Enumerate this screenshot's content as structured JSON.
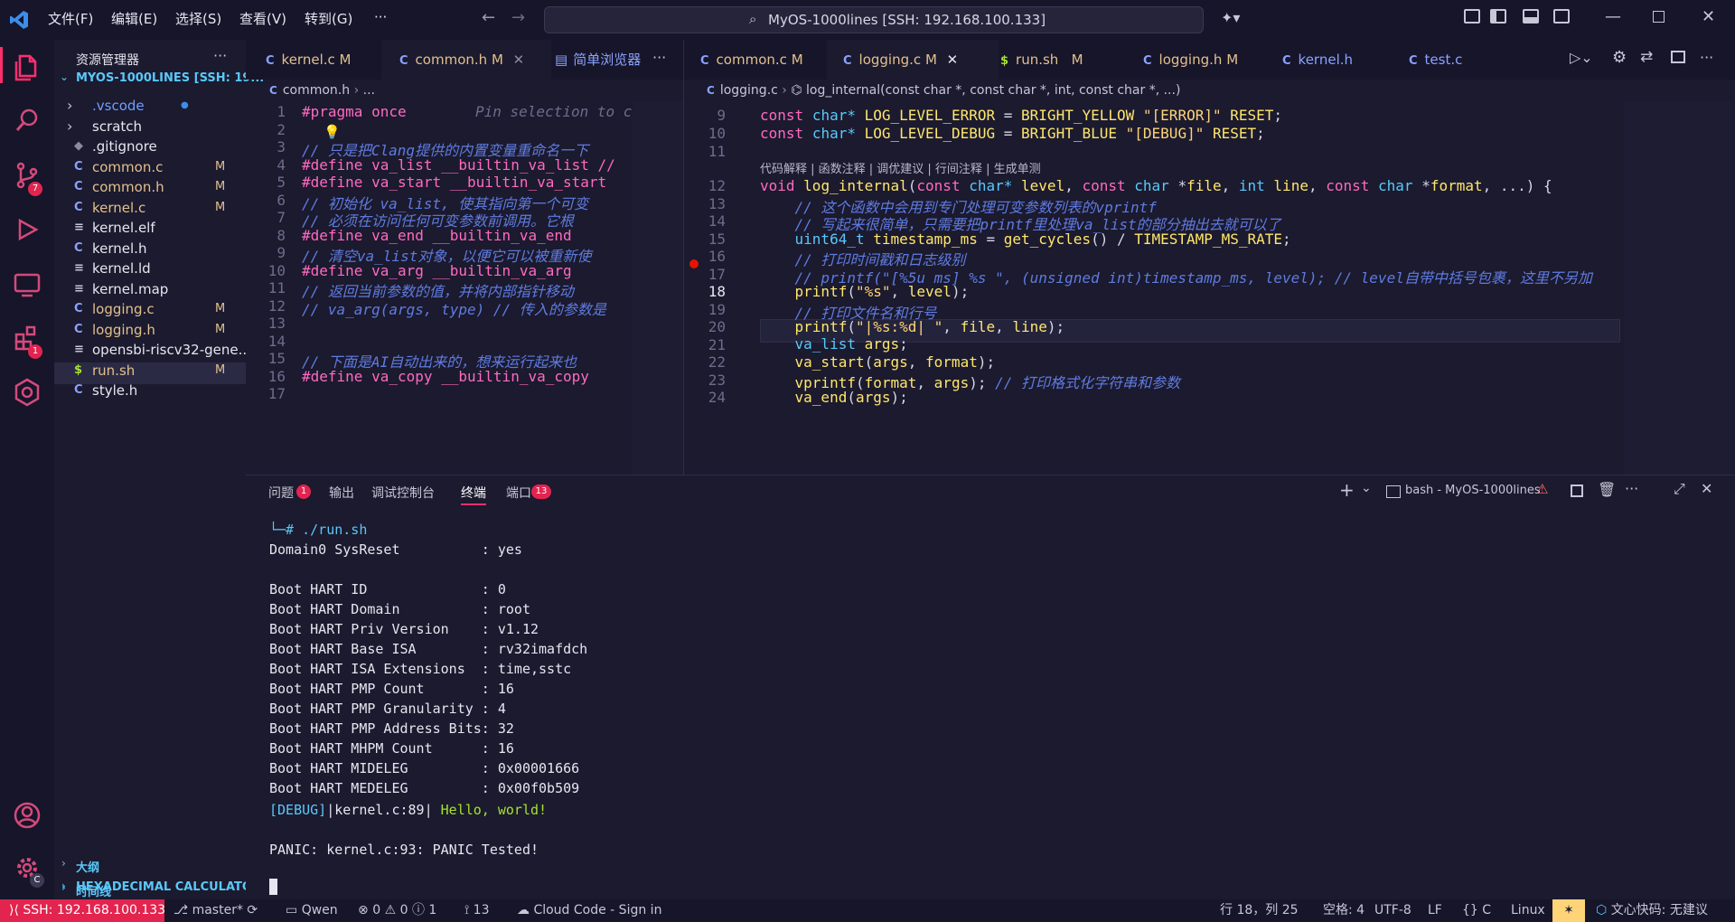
{
  "titlebar": {
    "menus": [
      "文件(F)",
      "编辑(E)",
      "选择(S)",
      "查看(V)",
      "转到(G)",
      "···"
    ],
    "search_text": "MyOS-1000lines [SSH: 192.168.100.133]"
  },
  "activity": {
    "scm_badge": "7",
    "ext_badge": "1"
  },
  "sidebar": {
    "title": "资源管理器",
    "folder": "MYOS-1000LINES [SSH: 19...",
    "items": [
      {
        "type": "folder",
        "name": ".vscode",
        "mark": "●",
        "color": "#6e9fff"
      },
      {
        "type": "folder",
        "name": "scratch",
        "mark": "",
        "color": "#e6e6f0"
      },
      {
        "type": "git",
        "name": ".gitignore",
        "mark": "",
        "color": "#e6e6f0"
      },
      {
        "type": "c",
        "name": "common.c",
        "mark": "M",
        "color": "#e2c08d"
      },
      {
        "type": "c",
        "name": "common.h",
        "mark": "M",
        "color": "#e2c08d"
      },
      {
        "type": "c",
        "name": "kernel.c",
        "mark": "M",
        "color": "#e2c08d"
      },
      {
        "type": "file",
        "name": "kernel.elf",
        "mark": "",
        "color": "#e6e6f0"
      },
      {
        "type": "c",
        "name": "kernel.h",
        "mark": "",
        "color": "#e6e6f0"
      },
      {
        "type": "file",
        "name": "kernel.ld",
        "mark": "",
        "color": "#e6e6f0"
      },
      {
        "type": "file",
        "name": "kernel.map",
        "mark": "",
        "color": "#e6e6f0"
      },
      {
        "type": "c",
        "name": "logging.c",
        "mark": "M",
        "color": "#e2c08d"
      },
      {
        "type": "c",
        "name": "logging.h",
        "mark": "M",
        "color": "#e2c08d"
      },
      {
        "type": "file",
        "name": "opensbi-riscv32-gene...",
        "mark": "",
        "color": "#e6e6f0"
      },
      {
        "type": "sh",
        "name": "run.sh",
        "mark": "M",
        "color": "#e2c08d"
      },
      {
        "type": "c",
        "name": "style.h",
        "mark": "",
        "color": "#e6e6f0"
      }
    ],
    "outline": "大纲",
    "timeline": "时间线",
    "hexcalc": "HEXADECIMAL CALCULATOR"
  },
  "left_editor": {
    "tabs": [
      {
        "name": "kernel.c",
        "mark": "M"
      },
      {
        "name": "common.h",
        "mark": "M"
      },
      {
        "name": "简单浏览器",
        "mark": ""
      }
    ],
    "breadcrumb_file": "common.h",
    "breadcrumb_rest": "...",
    "lines": [
      "1",
      "2",
      "3",
      "4",
      "5",
      "6",
      "7",
      "8",
      "9",
      "10",
      "11",
      "12",
      "13",
      "14",
      "15",
      "16",
      "17"
    ],
    "code": [
      "#pragma once",
      "",
      "// 只是把Clang提供的内置变量重命名一下",
      "#define va_list __builtin_va_list //",
      "#define va_start __builtin_va_start",
      "// 初始化 va_list, 使其指向第一个可变",
      "// 必须在访问任何可变参数前调用。它根",
      "#define va_end __builtin_va_end",
      "// 清空va_list对象，以便它可以被重新使",
      "#define va_arg __builtin_va_arg",
      "// 返回当前参数的值，并将内部指针移动",
      "// va_arg(args, type) // 传入的参数是",
      "",
      "",
      "// 下面是AI自动出来的，想来运行起来也",
      "#define va_copy __builtin_va_copy",
      ""
    ],
    "ghost_hint": "Pin selection to c"
  },
  "right_editor": {
    "tabs": [
      {
        "name": "common.c",
        "mark": "M"
      },
      {
        "name": "logging.c",
        "mark": "M"
      },
      {
        "name": "run.sh",
        "mark": "M"
      },
      {
        "name": "logging.h",
        "mark": "M"
      },
      {
        "name": "kernel.h",
        "mark": ""
      },
      {
        "name": "test.c",
        "mark": ""
      }
    ],
    "breadcrumb_file": "logging.c",
    "breadcrumb_symbol": "log_internal(const char *, const char *, int, const char *, ...)",
    "codelens": "代码解释 | 函数注释 | 调优建议 | 行间注释 | 生成单测",
    "lines_top": [
      "9",
      "10",
      "11"
    ],
    "lines": [
      "12",
      "13",
      "14",
      "15",
      "16",
      "17",
      "18",
      "19",
      "20",
      "21",
      "22",
      "23",
      "24"
    ],
    "code_9": "const char* LOG_LEVEL_ERROR = BRIGHT_YELLOW \"[ERROR]\" RESET;",
    "code_10": "const char* LOG_LEVEL_DEBUG = BRIGHT_BLUE \"[DEBUG]\" RESET;",
    "code_12": "void log_internal(const char* level, const char *file, int line, const char *format, ...) {",
    "code_13": "    // 这个函数中会用到专门处理可变参数列表的vprintf",
    "code_14": "    // 写起来很简单，只需要把printf里处理va_list的部分抽出去就可以了",
    "code_15": "    uint64_t timestamp_ms = get_cycles() / TIMESTAMP_MS_RATE;",
    "code_16": "    // 打印时间戳和日志级别",
    "code_17": "    // printf(\"[%5u ms] %s \", (unsigned int)timestamp_ms, level); // level自带中括号包裹，这里不另加",
    "code_18": "    printf(\"%s\", level);",
    "code_19": "    // 打印文件名和行号",
    "code_20": "    printf(\"|%s:%d| \", file, line);",
    "code_21": "    va_list args;",
    "code_22": "    va_start(args, format);",
    "code_23": "    vprintf(format, args); // 打印格式化字符串和参数",
    "code_24": "    va_end(args);"
  },
  "panel": {
    "tabs": [
      "问题",
      "输出",
      "调试控制台",
      "终端",
      "端口"
    ],
    "problems_badge": "1",
    "ports_badge": "13",
    "terminal_name": "bash - MyOS-1000lines",
    "terminal_lines": [
      "└─# ./run.sh",
      "Domain0 SysReset          : yes",
      "",
      "Boot HART ID              : 0",
      "Boot HART Domain          : root",
      "Boot HART Priv Version    : v1.12",
      "Boot HART Base ISA        : rv32imafdch",
      "Boot HART ISA Extensions  : time,sstc",
      "Boot HART PMP Count       : 16",
      "Boot HART PMP Granularity : 4",
      "Boot HART PMP Address Bits: 32",
      "Boot HART MHPM Count      : 16",
      "Boot HART MIDELEG         : 0x00001666",
      "Boot HART MEDELEG         : 0x00f0b509"
    ],
    "debug_tag": "[DEBUG]",
    "debug_loc": "|kernel.c:89|",
    "debug_msg": " Hello, world!",
    "panic_line": "PANIC: kernel.c:93: PANIC Tested!"
  },
  "statusbar": {
    "remote": "SSH: 192.168.100.133",
    "branch": "master*",
    "qwen": "Qwen",
    "errors": "0",
    "warnings": "0",
    "infos": "1",
    "ports": "13",
    "cloud": "Cloud Code - Sign in",
    "position": "行 18，列 25",
    "spaces": "空格: 4",
    "encoding": "UTF-8",
    "eol": "LF",
    "language": "C",
    "os": "Linux",
    "wenxin": "文心快码: 无建议"
  },
  "colors": {
    "accent": "#ff2e6e",
    "remote_bg": "#e2244f",
    "badge": "#e2244f"
  }
}
